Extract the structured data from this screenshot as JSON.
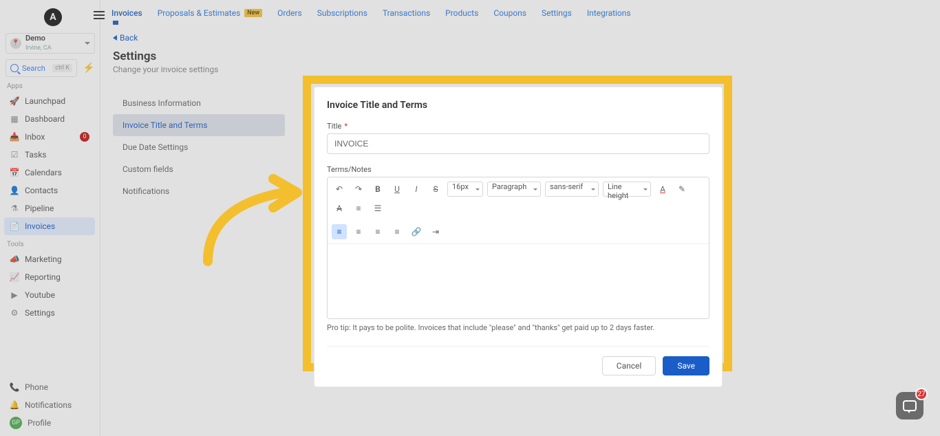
{
  "logo_letter": "A",
  "topnav": {
    "items": [
      {
        "label": "Invoices",
        "active": true,
        "dropdown": true
      },
      {
        "label": "Proposals & Estimates",
        "badge": "New"
      },
      {
        "label": "Orders"
      },
      {
        "label": "Subscriptions"
      },
      {
        "label": "Transactions"
      },
      {
        "label": "Products"
      },
      {
        "label": "Coupons"
      },
      {
        "label": "Settings"
      },
      {
        "label": "Integrations"
      }
    ]
  },
  "account": {
    "name": "Demo",
    "location": "Irvine, CA"
  },
  "search": {
    "placeholder": "Search",
    "shortcut": "ctrl K"
  },
  "side_labels": {
    "apps": "Apps",
    "tools": "Tools"
  },
  "side_apps": [
    {
      "label": "Launchpad",
      "icon": "rocket"
    },
    {
      "label": "Dashboard",
      "icon": "grid"
    },
    {
      "label": "Inbox",
      "icon": "inbox",
      "badge": "0"
    },
    {
      "label": "Tasks",
      "icon": "check"
    },
    {
      "label": "Calendars",
      "icon": "calendar"
    },
    {
      "label": "Contacts",
      "icon": "user"
    },
    {
      "label": "Pipeline",
      "icon": "funnel"
    },
    {
      "label": "Invoices",
      "icon": "doc",
      "active": true
    }
  ],
  "side_tools": [
    {
      "label": "Marketing",
      "icon": "megaphone"
    },
    {
      "label": "Reporting",
      "icon": "chart"
    },
    {
      "label": "Youtube",
      "icon": "video"
    },
    {
      "label": "Settings",
      "icon": "gear"
    }
  ],
  "side_bottom": [
    {
      "label": "Phone",
      "icon": "phone"
    },
    {
      "label": "Notifications",
      "icon": "bell"
    },
    {
      "label": "Profile",
      "avatar": "GP"
    }
  ],
  "back_label": "Back",
  "page": {
    "title": "Settings",
    "subtitle": "Change your invoice settings"
  },
  "settings_tabs": [
    {
      "label": "Business Information"
    },
    {
      "label": "Invoice Title and Terms",
      "active": true
    },
    {
      "label": "Due Date Settings"
    },
    {
      "label": "Custom fields"
    },
    {
      "label": "Notifications"
    }
  ],
  "modal": {
    "heading": "Invoice Title and Terms",
    "title_label": "Title",
    "title_value": "INVOICE",
    "terms_label": "Terms/Notes",
    "toolbar": {
      "font_size": "16px",
      "paragraph": "Paragraph",
      "font_family": "sans-serif",
      "line_height": "Line height"
    },
    "protip": "Pro tip: It pays to be polite. Invoices that include \"please\" and \"thanks\" get paid up to 2 days faster.",
    "cancel": "Cancel",
    "save": "Save"
  },
  "chat_count": "27"
}
